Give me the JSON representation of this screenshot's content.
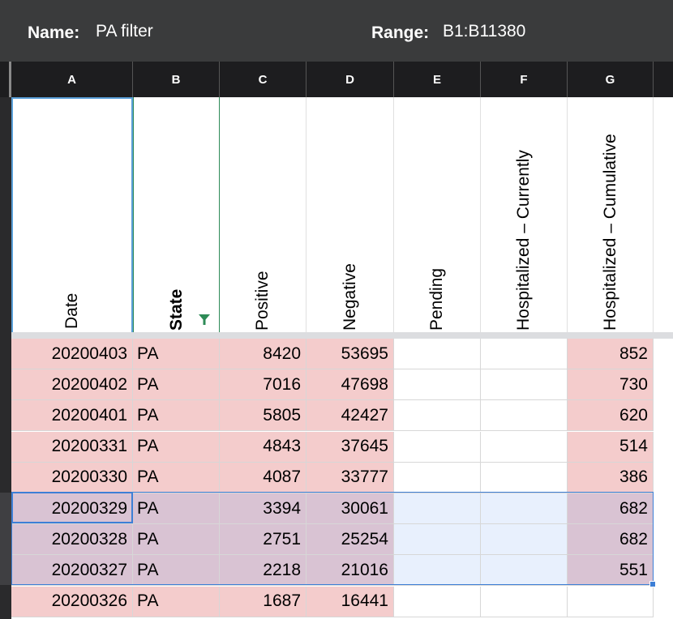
{
  "named_range": {
    "name_label": "Name:",
    "name_value": "PA filter",
    "range_label": "Range:",
    "range_value": "B1:B11380"
  },
  "columns": [
    "A",
    "B",
    "C",
    "D",
    "E",
    "F",
    "G"
  ],
  "headers": [
    "Date",
    "State",
    "Positive",
    "Negative",
    "Pending",
    "Hospitalized – Currently",
    "Hospitalized – Cumulative"
  ],
  "rows": [
    {
      "date": "20200403",
      "state": "PA",
      "positive": "8420",
      "negative": "53695",
      "pending": "",
      "hosp_current": "",
      "hosp_cumulative": "852"
    },
    {
      "date": "20200402",
      "state": "PA",
      "positive": "7016",
      "negative": "47698",
      "pending": "",
      "hosp_current": "",
      "hosp_cumulative": "730"
    },
    {
      "date": "20200401",
      "state": "PA",
      "positive": "5805",
      "negative": "42427",
      "pending": "",
      "hosp_current": "",
      "hosp_cumulative": "620"
    },
    {
      "date": "20200331",
      "state": "PA",
      "positive": "4843",
      "negative": "37645",
      "pending": "",
      "hosp_current": "",
      "hosp_cumulative": "514"
    },
    {
      "date": "20200330",
      "state": "PA",
      "positive": "4087",
      "negative": "33777",
      "pending": "",
      "hosp_current": "",
      "hosp_cumulative": "386"
    },
    {
      "date": "20200329",
      "state": "PA",
      "positive": "3394",
      "negative": "30061",
      "pending": "",
      "hosp_current": "",
      "hosp_cumulative": "682"
    },
    {
      "date": "20200328",
      "state": "PA",
      "positive": "2751",
      "negative": "25254",
      "pending": "",
      "hosp_current": "",
      "hosp_cumulative": "682"
    },
    {
      "date": "20200327",
      "state": "PA",
      "positive": "2218",
      "negative": "21016",
      "pending": "",
      "hosp_current": "",
      "hosp_cumulative": "551"
    },
    {
      "date": "20200326",
      "state": "PA",
      "positive": "1687",
      "negative": "16441",
      "pending": "",
      "hosp_current": "",
      "hosp_cumulative": ""
    }
  ],
  "colors": {
    "highlight_pink": "#f4cccc",
    "selection_overlap": "#d9c3d3",
    "selection_blue": "#e8f0fd",
    "selection_border": "#3d7fd6",
    "filter_green": "#2e8b57"
  }
}
